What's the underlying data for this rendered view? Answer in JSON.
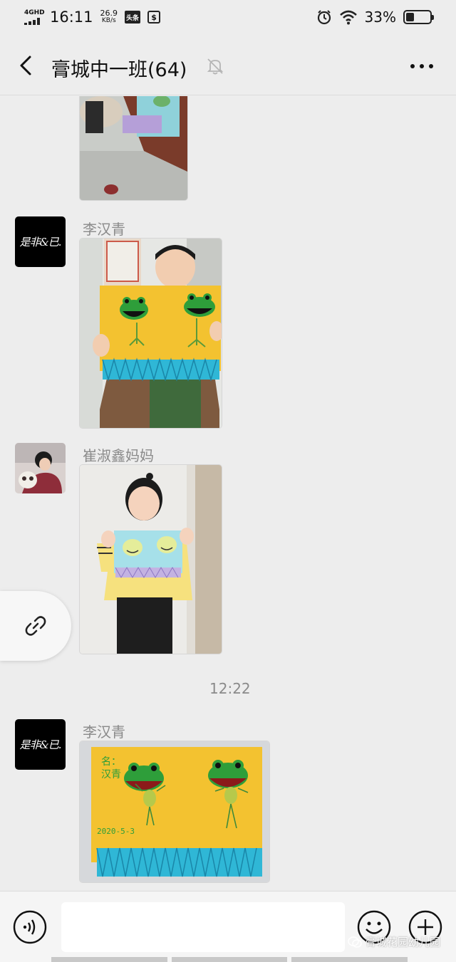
{
  "status_bar": {
    "network": "4GHD",
    "time": "16:11",
    "speed_value": "26.9",
    "speed_unit": "KB/s",
    "app_badge": "头条",
    "battery_percent": "33%",
    "battery_level": 0.33
  },
  "header": {
    "title": "膏城中一班(64)",
    "icons": [
      "back-arrow-icon",
      "mute-bell-icon",
      "more-icon"
    ]
  },
  "messages": [
    {
      "sender": "",
      "type": "image",
      "content": "partial photo of child craft at table (cut off at top)"
    },
    {
      "sender": "李汉青",
      "avatar": "calligraphy-logo",
      "type": "image"
    },
    {
      "sender": "崔淑鑫妈妈",
      "avatar": "photo-child",
      "type": "image"
    },
    {
      "sender": "李汉青",
      "avatar": "calligraphy-logo",
      "type": "image"
    }
  ],
  "avatar_logo_text": "是非&已.",
  "timestamp": "12:22",
  "photo_scrawl": {
    "name": "名：汉青",
    "date": "2020-5-3"
  },
  "input_bar": {
    "placeholder": "",
    "icons": [
      "voice-icon",
      "emoji-icon",
      "plus-icon"
    ]
  },
  "watermark": "膏城花园幼儿园",
  "colors": {
    "background": "#ededed",
    "frog_green": "#2e9e3a",
    "paper_yellow": "#f3c230",
    "paper_blue": "#a6e0e9",
    "fringe_blue": "#2fb7d6"
  }
}
